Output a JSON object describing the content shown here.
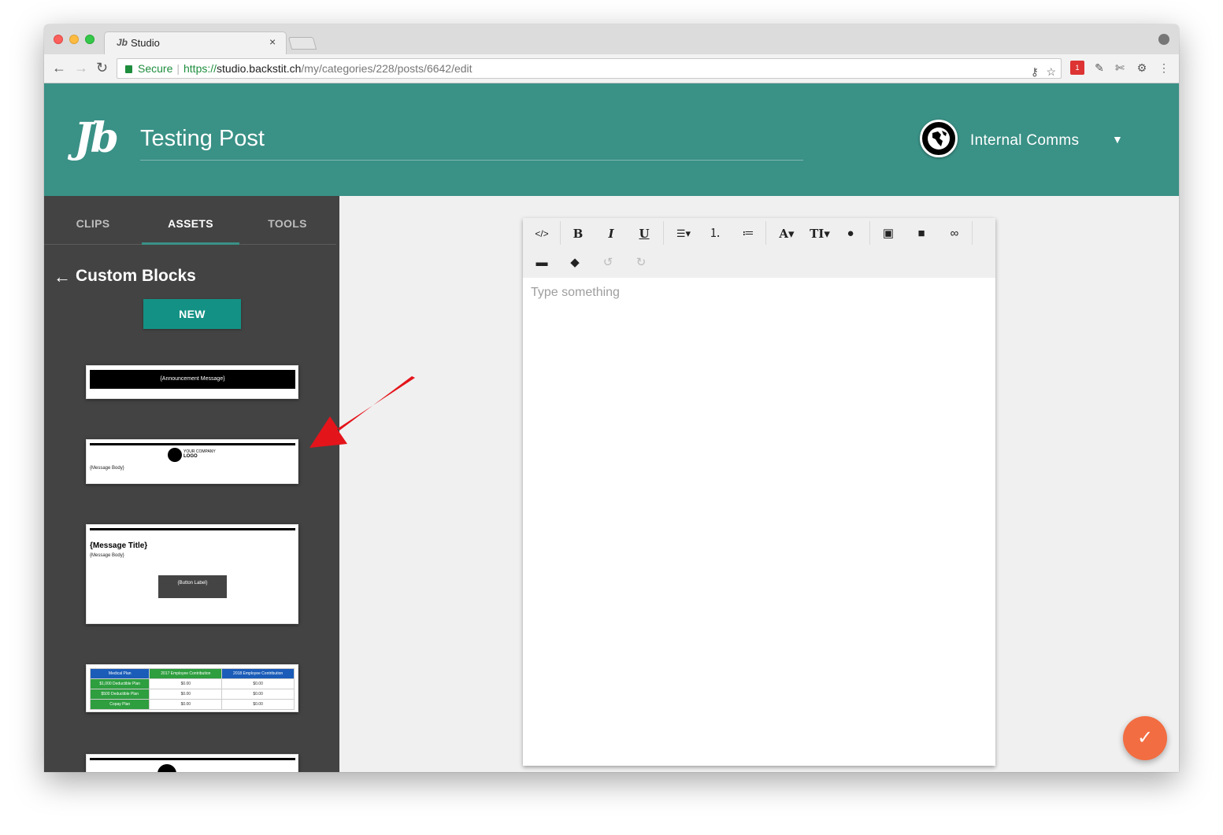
{
  "browser": {
    "tab_title": "Studio",
    "tab_favicon": "Jb",
    "tab_close": "×",
    "security_label": "Secure",
    "url_scheme": "https://",
    "url_host": "studio.backstit.ch",
    "url_path": "/my/categories/228/posts/6642/edit",
    "nav_icons": [
      "back-arrow-icon",
      "forward-arrow-icon",
      "reload-icon"
    ],
    "omnibox_icons": [
      "key-icon",
      "star-icon"
    ],
    "extension_badge": "1"
  },
  "header": {
    "logo_text": "Jb",
    "post_title": "Testing Post",
    "org_name": "Internal Comms",
    "accent_color": "#3a9186"
  },
  "sidebar": {
    "tabs": [
      {
        "label": "CLIPS"
      },
      {
        "label": "ASSETS"
      },
      {
        "label": "TOOLS"
      }
    ],
    "active_tab": "ASSETS",
    "section_title": "Custom Blocks",
    "new_button": "NEW",
    "blocks": {
      "announcement": "{Announcement Message}",
      "logo_company": "YOUR COMPANY",
      "logo_word": "LOGO",
      "message_body": "{Message Body}",
      "message_title": "{Message Title}",
      "button_label": "{Button Label}",
      "table": {
        "headers": [
          "Medical Plan",
          "2017 Employee Contribution",
          "2018 Employee Contribution"
        ],
        "rows": [
          [
            "$1,000 Deductible Plan",
            "$0.00",
            "$0.00"
          ],
          [
            "$500 Deductible Plan",
            "$0.00",
            "$0.00"
          ],
          [
            "Copay Plan",
            "$0.00",
            "$0.00"
          ]
        ]
      }
    }
  },
  "editor": {
    "toolbar_icons": [
      "code-view-icon",
      "bold-icon",
      "italic-icon",
      "underline-icon",
      "align-icon",
      "ordered-list-icon",
      "unordered-list-icon",
      "font-color-icon",
      "font-size-icon",
      "ink-drop-icon",
      "image-icon",
      "video-icon",
      "link-icon",
      "horizontal-rule-icon",
      "eraser-icon",
      "undo-icon",
      "redo-icon"
    ],
    "placeholder": "Type something"
  },
  "fab": {
    "icon": "check-icon",
    "color": "#f26d42"
  }
}
